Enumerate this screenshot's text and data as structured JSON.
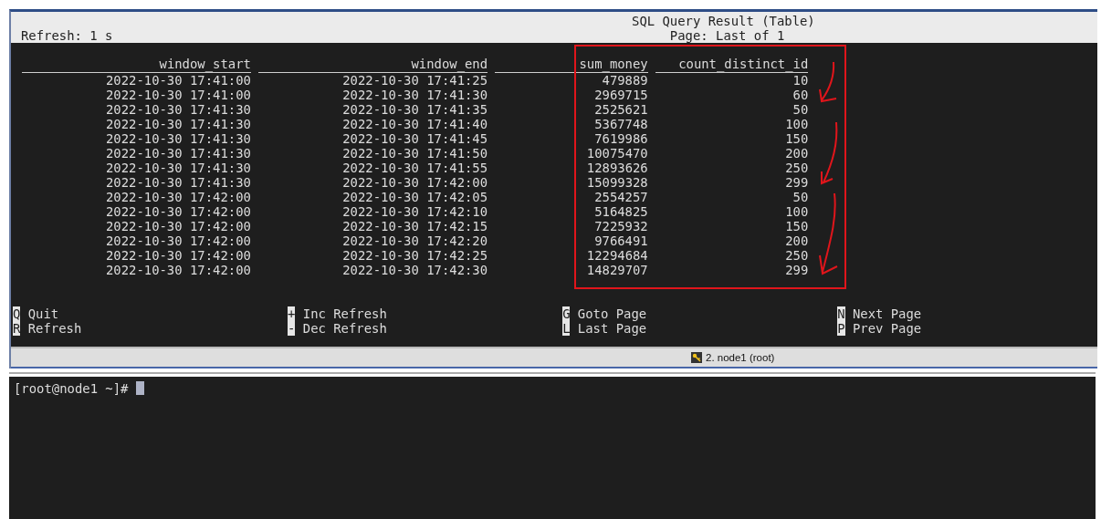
{
  "header": {
    "title": "SQL Query Result (Table)",
    "refresh": "Refresh: 1 s",
    "page": "Page: Last of 1"
  },
  "table": {
    "columns": [
      "window_start",
      "window_end",
      "sum_money",
      "count_distinct_id"
    ],
    "rows": [
      [
        "2022-10-30 17:41:00",
        "2022-10-30 17:41:25",
        "479889",
        "10"
      ],
      [
        "2022-10-30 17:41:00",
        "2022-10-30 17:41:30",
        "2969715",
        "60"
      ],
      [
        "2022-10-30 17:41:30",
        "2022-10-30 17:41:35",
        "2525621",
        "50"
      ],
      [
        "2022-10-30 17:41:30",
        "2022-10-30 17:41:40",
        "5367748",
        "100"
      ],
      [
        "2022-10-30 17:41:30",
        "2022-10-30 17:41:45",
        "7619986",
        "150"
      ],
      [
        "2022-10-30 17:41:30",
        "2022-10-30 17:41:50",
        "10075470",
        "200"
      ],
      [
        "2022-10-30 17:41:30",
        "2022-10-30 17:41:55",
        "12893626",
        "250"
      ],
      [
        "2022-10-30 17:41:30",
        "2022-10-30 17:42:00",
        "15099328",
        "299"
      ],
      [
        "2022-10-30 17:42:00",
        "2022-10-30 17:42:05",
        "2554257",
        "50"
      ],
      [
        "2022-10-30 17:42:00",
        "2022-10-30 17:42:10",
        "5164825",
        "100"
      ],
      [
        "2022-10-30 17:42:00",
        "2022-10-30 17:42:15",
        "7225932",
        "150"
      ],
      [
        "2022-10-30 17:42:00",
        "2022-10-30 17:42:20",
        "9766491",
        "200"
      ],
      [
        "2022-10-30 17:42:00",
        "2022-10-30 17:42:25",
        "12294684",
        "250"
      ],
      [
        "2022-10-30 17:42:00",
        "2022-10-30 17:42:30",
        "14829707",
        "299"
      ]
    ]
  },
  "shortcuts": [
    {
      "key": "Q",
      "label": "Quit"
    },
    {
      "key": "+",
      "label": "Inc Refresh"
    },
    {
      "key": "G",
      "label": "Goto Page"
    },
    {
      "key": "N",
      "label": "Next Page"
    },
    {
      "key": "R",
      "label": "Refresh"
    },
    {
      "key": "-",
      "label": "Dec Refresh"
    },
    {
      "key": "L",
      "label": "Last Page"
    },
    {
      "key": "P",
      "label": "Prev Page"
    }
  ],
  "tab": {
    "label": "2. node1 (root)"
  },
  "prompt": "[root@node1 ~]#"
}
